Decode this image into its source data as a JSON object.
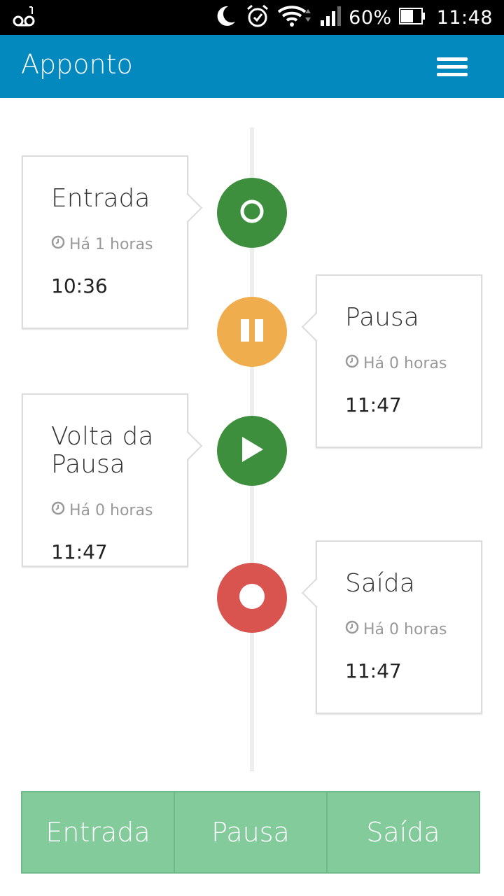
{
  "status_bar": {
    "battery": "60%",
    "time": "11:48",
    "icons": [
      "voicemail-icon",
      "moon-icon",
      "alarm-icon",
      "wifi-icon",
      "signal-icon",
      "battery-icon"
    ]
  },
  "app_bar": {
    "title": "Apponto",
    "menu_icon": "hamburger-menu-icon",
    "color": "#0389be"
  },
  "timeline": [
    {
      "title": "Entrada",
      "ago": "Há 1 horas",
      "time": "10:36",
      "icon": "circle-icon",
      "color": "#3d8f3d"
    },
    {
      "title": "Pausa",
      "ago": "Há 0 horas",
      "time": "11:47",
      "icon": "pause-icon",
      "color": "#f0ad4e"
    },
    {
      "title": "Volta da Pausa",
      "ago": "Há 0 horas",
      "time": "11:47",
      "icon": "play-icon",
      "color": "#3d8f3d"
    },
    {
      "title": "Saída",
      "ago": "Há 0 horas",
      "time": "11:47",
      "icon": "dot-icon",
      "color": "#d9534f"
    }
  ],
  "actions": {
    "entrada": "Entrada",
    "pausa": "Pausa",
    "saida": "Saída",
    "color": "#84cb9c"
  }
}
